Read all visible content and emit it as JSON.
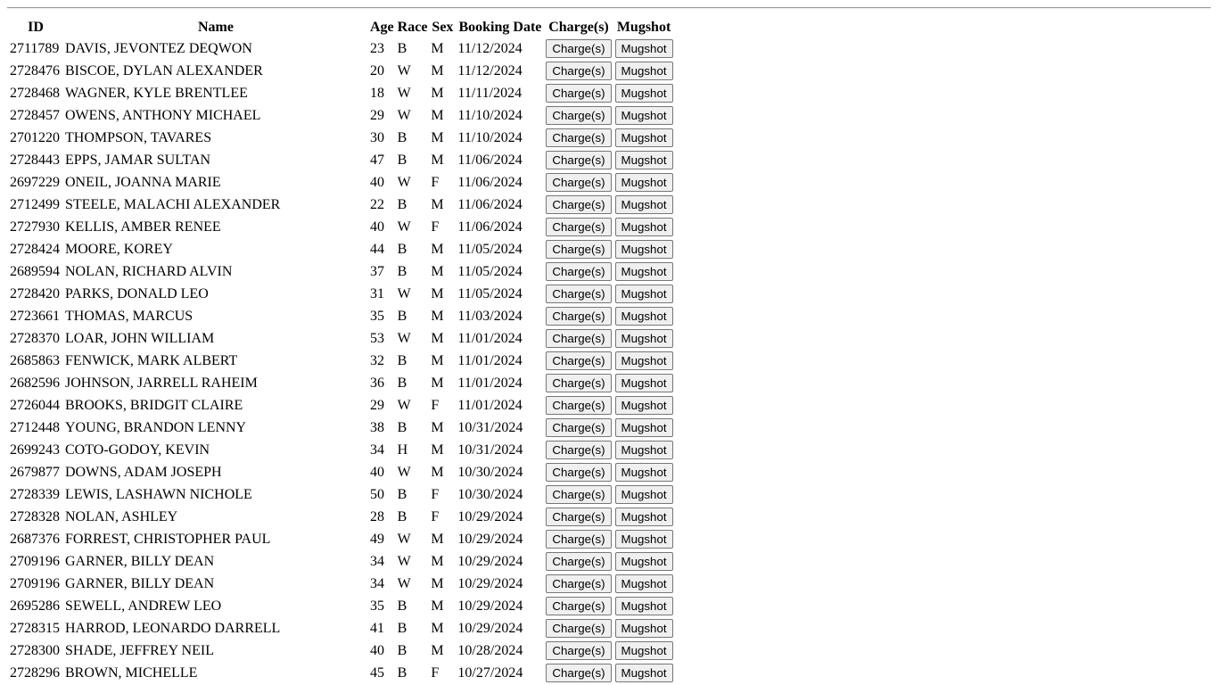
{
  "table": {
    "headers": {
      "id": "ID",
      "name": "Name",
      "age": "Age",
      "race": "Race",
      "sex": "Sex",
      "booking_date": "Booking Date",
      "charges": "Charge(s)",
      "mugshot": "Mugshot"
    },
    "button_labels": {
      "charges": "Charge(s)",
      "mugshot": "Mugshot"
    },
    "rows": [
      {
        "id": "2711789",
        "name": "DAVIS, JEVONTEZ DEQWON",
        "age": "23",
        "race": "B",
        "sex": "M",
        "booking_date": "11/12/2024"
      },
      {
        "id": "2728476",
        "name": "BISCOE, DYLAN ALEXANDER",
        "age": "20",
        "race": "W",
        "sex": "M",
        "booking_date": "11/12/2024"
      },
      {
        "id": "2728468",
        "name": "WAGNER, KYLE BRENTLEE",
        "age": "18",
        "race": "W",
        "sex": "M",
        "booking_date": "11/11/2024"
      },
      {
        "id": "2728457",
        "name": "OWENS, ANTHONY MICHAEL",
        "age": "29",
        "race": "W",
        "sex": "M",
        "booking_date": "11/10/2024"
      },
      {
        "id": "2701220",
        "name": "THOMPSON, TAVARES",
        "age": "30",
        "race": "B",
        "sex": "M",
        "booking_date": "11/10/2024"
      },
      {
        "id": "2728443",
        "name": "EPPS, JAMAR SULTAN",
        "age": "47",
        "race": "B",
        "sex": "M",
        "booking_date": "11/06/2024"
      },
      {
        "id": "2697229",
        "name": "ONEIL, JOANNA MARIE",
        "age": "40",
        "race": "W",
        "sex": "F",
        "booking_date": "11/06/2024"
      },
      {
        "id": "2712499",
        "name": "STEELE, MALACHI ALEXANDER",
        "age": "22",
        "race": "B",
        "sex": "M",
        "booking_date": "11/06/2024"
      },
      {
        "id": "2727930",
        "name": "KELLIS, AMBER RENEE",
        "age": "40",
        "race": "W",
        "sex": "F",
        "booking_date": "11/06/2024"
      },
      {
        "id": "2728424",
        "name": "MOORE, KOREY",
        "age": "44",
        "race": "B",
        "sex": "M",
        "booking_date": "11/05/2024"
      },
      {
        "id": "2689594",
        "name": "NOLAN, RICHARD ALVIN",
        "age": "37",
        "race": "B",
        "sex": "M",
        "booking_date": "11/05/2024"
      },
      {
        "id": "2728420",
        "name": "PARKS, DONALD LEO",
        "age": "31",
        "race": "W",
        "sex": "M",
        "booking_date": "11/05/2024"
      },
      {
        "id": "2723661",
        "name": "THOMAS, MARCUS",
        "age": "35",
        "race": "B",
        "sex": "M",
        "booking_date": "11/03/2024"
      },
      {
        "id": "2728370",
        "name": "LOAR, JOHN WILLIAM",
        "age": "53",
        "race": "W",
        "sex": "M",
        "booking_date": "11/01/2024"
      },
      {
        "id": "2685863",
        "name": "FENWICK, MARK ALBERT",
        "age": "32",
        "race": "B",
        "sex": "M",
        "booking_date": "11/01/2024"
      },
      {
        "id": "2682596",
        "name": "JOHNSON, JARRELL RAHEIM",
        "age": "36",
        "race": "B",
        "sex": "M",
        "booking_date": "11/01/2024"
      },
      {
        "id": "2726044",
        "name": "BROOKS, BRIDGIT CLAIRE",
        "age": "29",
        "race": "W",
        "sex": "F",
        "booking_date": "11/01/2024"
      },
      {
        "id": "2712448",
        "name": "YOUNG, BRANDON LENNY",
        "age": "38",
        "race": "B",
        "sex": "M",
        "booking_date": "10/31/2024"
      },
      {
        "id": "2699243",
        "name": "COTO-GODOY, KEVIN",
        "age": "34",
        "race": "H",
        "sex": "M",
        "booking_date": "10/31/2024"
      },
      {
        "id": "2679877",
        "name": "DOWNS, ADAM JOSEPH",
        "age": "40",
        "race": "W",
        "sex": "M",
        "booking_date": "10/30/2024"
      },
      {
        "id": "2728339",
        "name": "LEWIS, LASHAWN NICHOLE",
        "age": "50",
        "race": "B",
        "sex": "F",
        "booking_date": "10/30/2024"
      },
      {
        "id": "2728328",
        "name": "NOLAN, ASHLEY",
        "age": "28",
        "race": "B",
        "sex": "F",
        "booking_date": "10/29/2024"
      },
      {
        "id": "2687376",
        "name": "FORREST, CHRISTOPHER PAUL",
        "age": "49",
        "race": "W",
        "sex": "M",
        "booking_date": "10/29/2024"
      },
      {
        "id": "2709196",
        "name": "GARNER, BILLY DEAN",
        "age": "34",
        "race": "W",
        "sex": "M",
        "booking_date": "10/29/2024"
      },
      {
        "id": "2709196",
        "name": "GARNER, BILLY DEAN",
        "age": "34",
        "race": "W",
        "sex": "M",
        "booking_date": "10/29/2024"
      },
      {
        "id": "2695286",
        "name": "SEWELL, ANDREW LEO",
        "age": "35",
        "race": "B",
        "sex": "M",
        "booking_date": "10/29/2024"
      },
      {
        "id": "2728315",
        "name": "HARROD, LEONARDO DARRELL",
        "age": "41",
        "race": "B",
        "sex": "M",
        "booking_date": "10/29/2024"
      },
      {
        "id": "2728300",
        "name": "SHADE, JEFFREY NEIL",
        "age": "40",
        "race": "B",
        "sex": "M",
        "booking_date": "10/28/2024"
      },
      {
        "id": "2728296",
        "name": "BROWN, MICHELLE",
        "age": "45",
        "race": "B",
        "sex": "F",
        "booking_date": "10/27/2024"
      }
    ]
  }
}
